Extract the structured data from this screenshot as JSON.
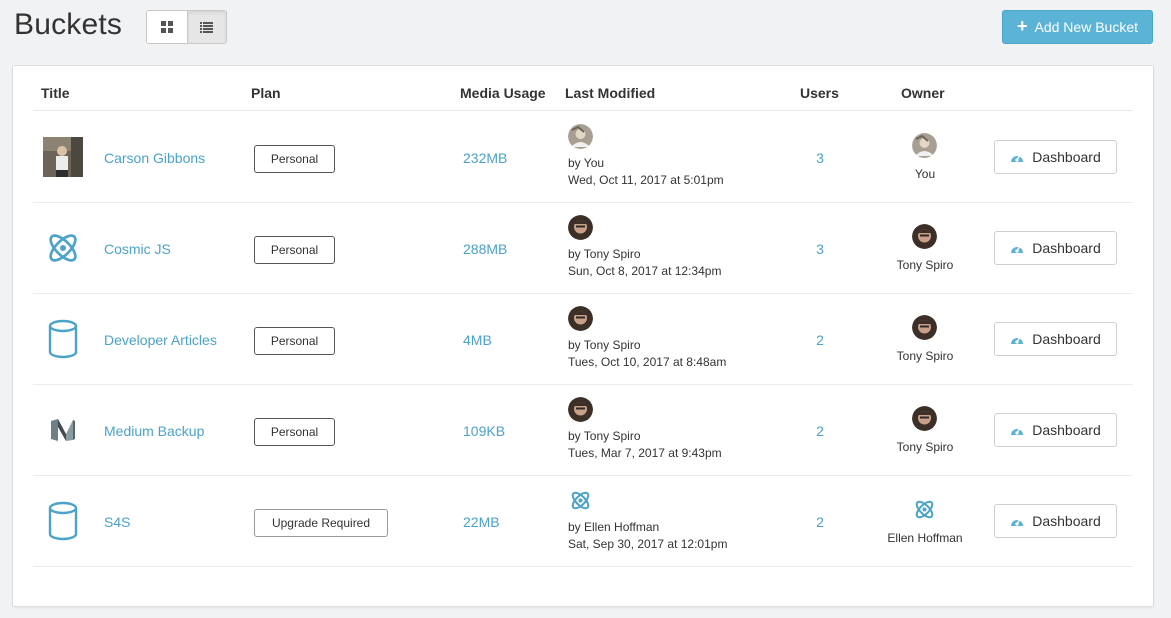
{
  "page": {
    "title": "Buckets",
    "add_button": "Add New Bucket"
  },
  "table": {
    "headers": {
      "title": "Title",
      "plan": "Plan",
      "media_usage": "Media Usage",
      "last_modified": "Last Modified",
      "users": "Users",
      "owner": "Owner"
    },
    "dashboard_label": "Dashboard",
    "rows": [
      {
        "title": "Carson Gibbons",
        "icon": "photo-thumbnail",
        "plan": "Personal",
        "media_usage": "232MB",
        "modified_by": "by You",
        "modified_date": "Wed, Oct 11, 2017 at 5:01pm",
        "users": "3",
        "owner": "You"
      },
      {
        "title": "Cosmic JS",
        "icon": "cosmic-logo-icon",
        "plan": "Personal",
        "media_usage": "288MB",
        "modified_by": "by Tony Spiro",
        "modified_date": "Sun, Oct 8, 2017 at 12:34pm",
        "users": "3",
        "owner": "Tony Spiro"
      },
      {
        "title": "Developer Articles",
        "icon": "database-icon",
        "plan": "Personal",
        "media_usage": "4MB",
        "modified_by": "by Tony Spiro",
        "modified_date": "Tues, Oct 10, 2017 at 8:48am",
        "users": "2",
        "owner": "Tony Spiro"
      },
      {
        "title": "Medium Backup",
        "icon": "medium-logo-icon",
        "plan": "Personal",
        "media_usage": "109KB",
        "modified_by": "by Tony Spiro",
        "modified_date": "Tues, Mar 7, 2017 at 9:43pm",
        "users": "2",
        "owner": "Tony Spiro"
      },
      {
        "title": "S4S",
        "icon": "database-icon",
        "plan": "Upgrade Required",
        "media_usage": "22MB",
        "modified_by": "by Ellen Hoffman",
        "modified_date": "Sat, Sep 30, 2017 at 12:01pm",
        "users": "2",
        "owner": "Ellen Hoffman"
      }
    ]
  },
  "colors": {
    "accent": "#4aa3c8",
    "button": "#5bb4d6",
    "background": "#f1f2f4"
  }
}
